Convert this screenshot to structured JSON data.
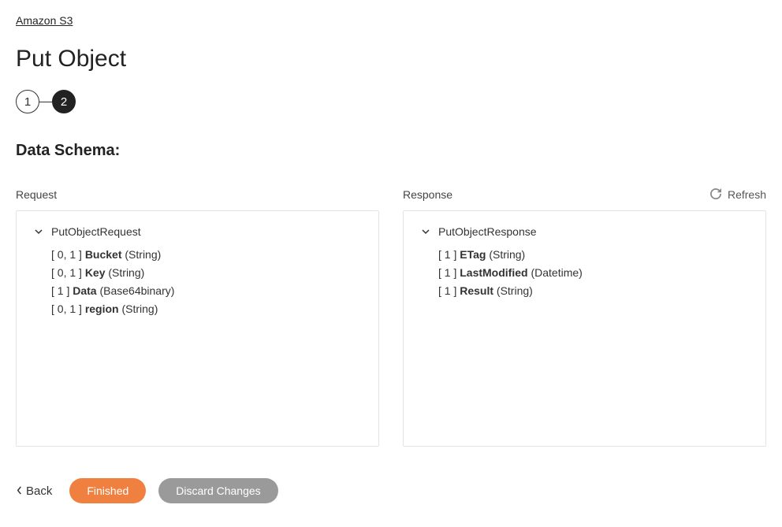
{
  "breadcrumb": "Amazon S3",
  "page_title": "Put Object",
  "stepper": {
    "s1": "1",
    "s2": "2"
  },
  "section_title": "Data Schema:",
  "columns": {
    "request_label": "Request",
    "response_label": "Response",
    "refresh_label": "Refresh"
  },
  "request": {
    "root": "PutObjectRequest",
    "items": [
      {
        "card": "[ 0, 1 ] ",
        "name": "Bucket",
        "type": " (String)"
      },
      {
        "card": "[ 0, 1 ] ",
        "name": "Key",
        "type": " (String)"
      },
      {
        "card": "[ 1 ] ",
        "name": "Data",
        "type": " (Base64binary)"
      },
      {
        "card": "[ 0, 1 ] ",
        "name": "region",
        "type": " (String)"
      }
    ]
  },
  "response": {
    "root": "PutObjectResponse",
    "items": [
      {
        "card": "[ 1 ] ",
        "name": "ETag",
        "type": " (String)"
      },
      {
        "card": "[ 1 ] ",
        "name": "LastModified",
        "type": " (Datetime)"
      },
      {
        "card": "[ 1 ] ",
        "name": "Result",
        "type": " (String)"
      }
    ]
  },
  "footer": {
    "back": "Back",
    "finished": "Finished",
    "discard": "Discard Changes"
  }
}
